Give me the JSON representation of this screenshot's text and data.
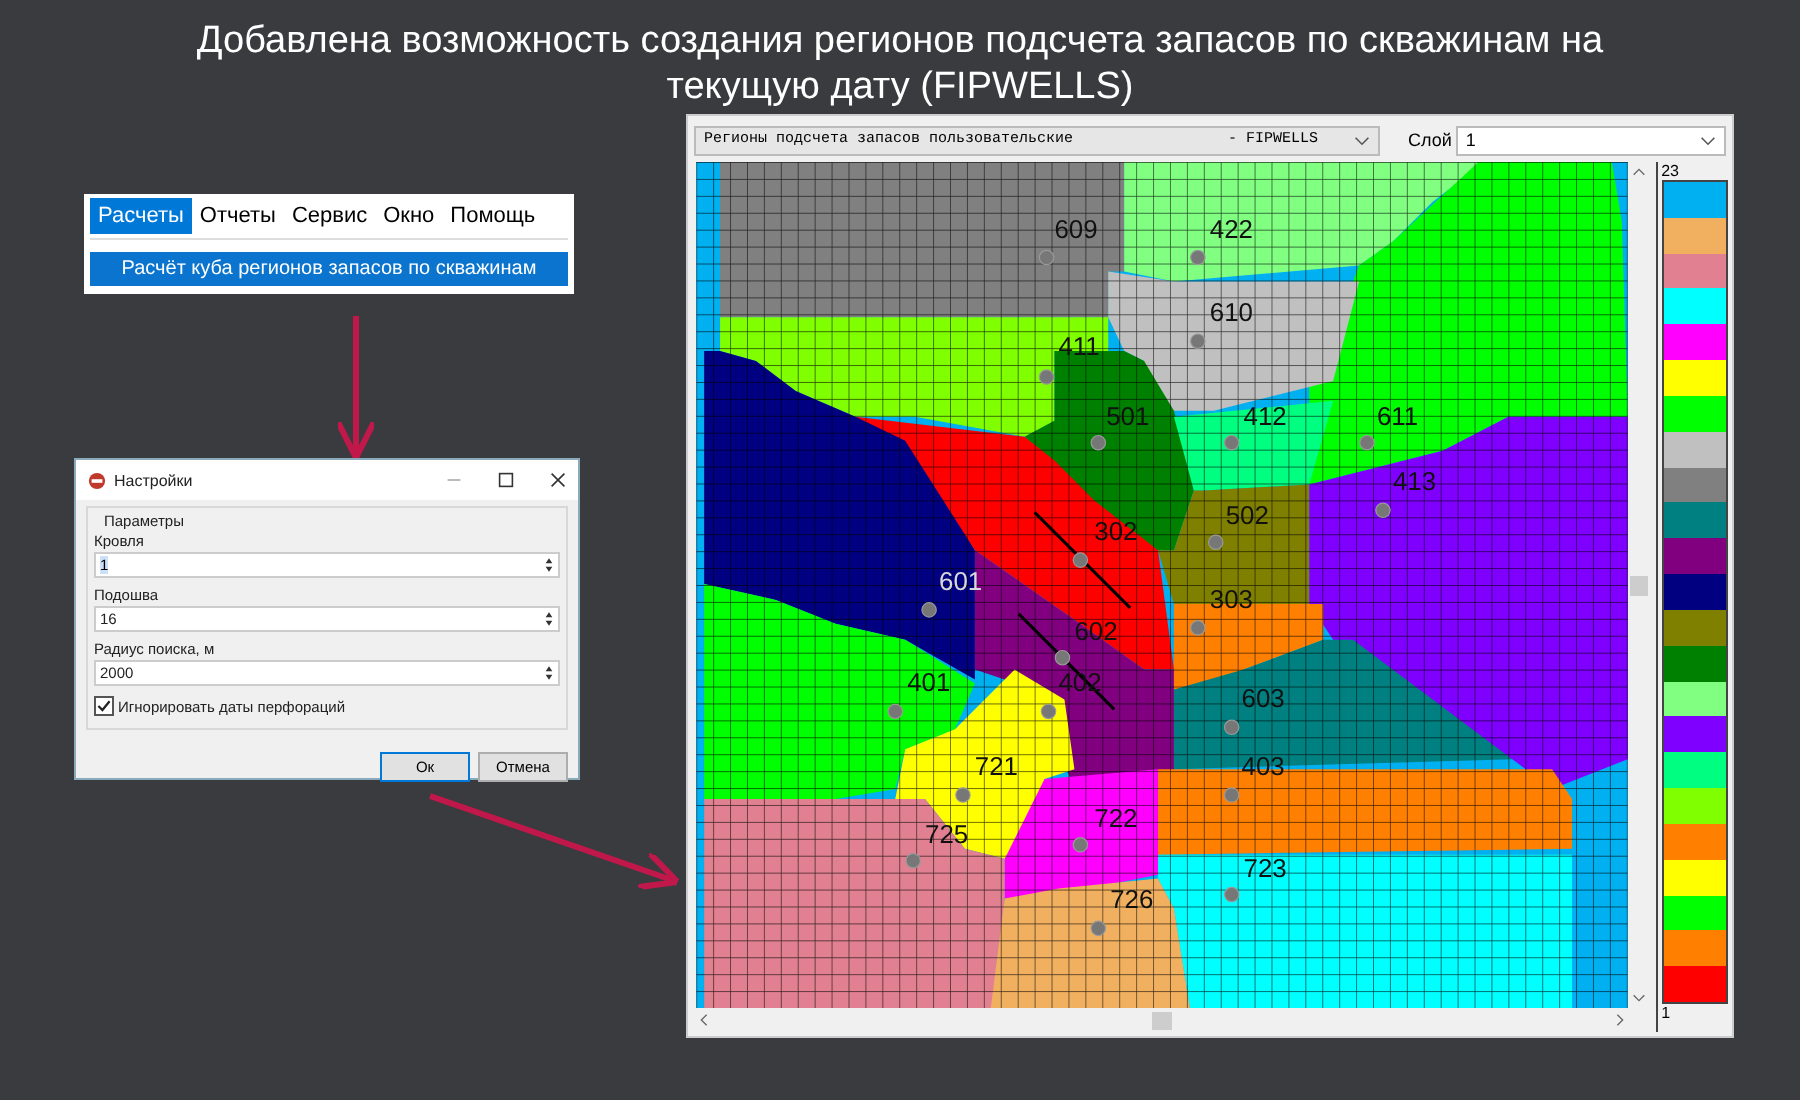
{
  "title": "Добавлена возможность создания регионов подсчета запасов по скважинам на текущую дату (FIPWELLS)",
  "menu": {
    "items": [
      {
        "label": "Расчеты",
        "selected": true
      },
      {
        "label": "Отчеты",
        "selected": false
      },
      {
        "label": "Сервис",
        "selected": false
      },
      {
        "label": "Окно",
        "selected": false
      },
      {
        "label": "Помощь",
        "selected": false
      }
    ],
    "dropdown_item": "Расчёт куба регионов запасов по скважинам"
  },
  "dialog": {
    "title": "Настройки",
    "group": "Параметры",
    "fields": [
      {
        "label": "Кровля",
        "value": "1"
      },
      {
        "label": "Подошва",
        "value": "16"
      },
      {
        "label": "Радиус поиска, м",
        "value": "2000"
      }
    ],
    "checkbox": {
      "label": "Игнорировать даты перфораций",
      "checked": true
    },
    "buttons": [
      {
        "label": "Ок",
        "default": true
      },
      {
        "label": "Отмена",
        "default": false
      }
    ]
  },
  "map_window": {
    "property_name": "Регионы подсчета запасов пользовательские",
    "property_suffix": "- FIPWELLS",
    "layer_label": "Слой",
    "layer_value": "1",
    "wells": [
      {
        "label": "609"
      },
      {
        "label": "422"
      },
      {
        "label": "610"
      },
      {
        "label": "411"
      },
      {
        "label": "501"
      },
      {
        "label": "412"
      },
      {
        "label": "611"
      },
      {
        "label": "413"
      },
      {
        "label": "502"
      },
      {
        "label": "302"
      },
      {
        "label": "601"
      },
      {
        "label": "303"
      },
      {
        "label": "602"
      },
      {
        "label": "402"
      },
      {
        "label": "401"
      },
      {
        "label": "603"
      },
      {
        "label": "721"
      },
      {
        "label": "403"
      },
      {
        "label": "722"
      },
      {
        "label": "725"
      },
      {
        "label": "723"
      },
      {
        "label": "726"
      }
    ],
    "palette": {
      "max": "23",
      "min": "1",
      "colors": [
        {
          "color": "#00b0f0"
        },
        {
          "color": "#f0b060"
        },
        {
          "color": "#e08090"
        },
        {
          "color": "#00ffff"
        },
        {
          "color": "#ff00ff"
        },
        {
          "color": "#ffff00"
        },
        {
          "color": "#00ff00"
        },
        {
          "color": "#c0c0c0"
        },
        {
          "color": "#808080"
        },
        {
          "color": "#008080"
        },
        {
          "color": "#800080"
        },
        {
          "color": "#000080"
        },
        {
          "color": "#808000"
        },
        {
          "color": "#008000"
        },
        {
          "color": "#80ff80"
        },
        {
          "color": "#8000ff"
        },
        {
          "color": "#00ff80"
        },
        {
          "color": "#80ff00"
        },
        {
          "color": "#ff8000"
        },
        {
          "color": "#ffff00"
        },
        {
          "color": "#00ff00"
        },
        {
          "color": "#ff8000"
        },
        {
          "color": "#ff0000"
        }
      ]
    }
  }
}
